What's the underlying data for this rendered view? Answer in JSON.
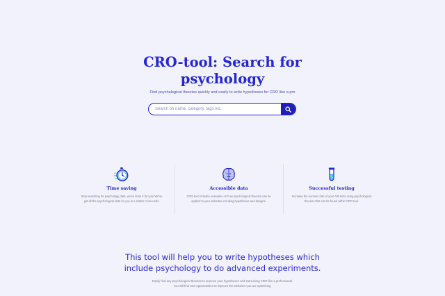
{
  "hero": {
    "title_line1": "CRO-tool: Search for",
    "title_line2": "psychology",
    "subtitle": "Find psychological theories quickly and easily to write hypotheses for CRO like a pro"
  },
  "search": {
    "placeholder": "Search on name, category, tags etc.",
    "value": "",
    "button_icon": "search-icon"
  },
  "features": [
    {
      "icon": "stopwatch-icon",
      "title": "Time saving",
      "text": "Stop searching for psychology data, we've done it for you! We've got all the psychological data for you in a matter of seconds."
    },
    {
      "icon": "brain-icon",
      "title": "Accessible data",
      "text": "CRO-tool includes examples on how psychological theories can be applied to your websites including hypotheses and designs."
    },
    {
      "icon": "test-tube-icon",
      "title": "Successful testing",
      "text": "Increase the success rate of your A/B tests using psychological theories that can be found within CRO-tool."
    }
  ],
  "section": {
    "title_line1": "This tool will help you to write hypotheses which",
    "title_line2": "include psychology to do advanced experiments.",
    "text": "Easily find any psychological theories to improve your hypotheses and start doing CRO like a professional. You will find new opportunities to improve the websites you are optimizing."
  },
  "colors": {
    "background": "#f1f2fb",
    "accent": "#2626d6",
    "button": "#1f1fb8",
    "muted_text": "#777a92"
  }
}
